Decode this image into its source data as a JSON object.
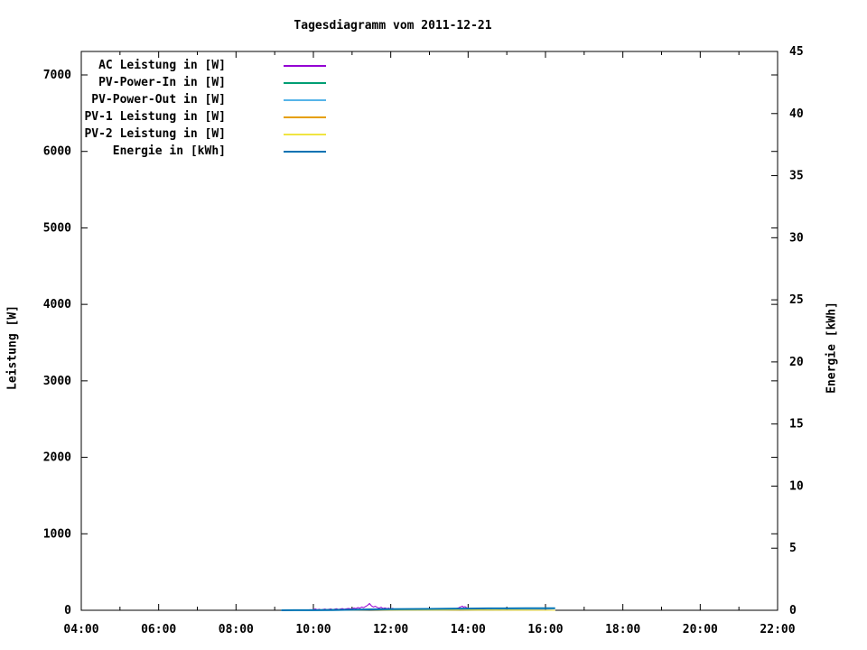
{
  "title": "Tagesdiagramm vom 2011-12-21",
  "chart_data": {
    "type": "line",
    "title": "Tagesdiagramm vom 2011-12-21",
    "background": "#ffffff",
    "grid": false,
    "legend_position": "top-left-inside",
    "x_axis": {
      "range_hours": [
        4,
        22
      ],
      "major_tick_hours": [
        4,
        6,
        8,
        10,
        12,
        14,
        16,
        18,
        20,
        22
      ],
      "minor_tick_hours": [
        5,
        7,
        9,
        11,
        13,
        15,
        17,
        19,
        21
      ],
      "tick_labels": [
        "04:00",
        "06:00",
        "08:00",
        "10:00",
        "12:00",
        "14:00",
        "16:00",
        "18:00",
        "20:00",
        "22:00"
      ]
    },
    "y_left": {
      "label": "Leistung [W]",
      "ticks": [
        0,
        1000,
        2000,
        3000,
        4000,
        5000,
        6000,
        7000
      ],
      "tick_labels": [
        "0",
        "1000",
        "2000",
        "3000",
        "4000",
        "5000",
        "6000",
        "7000"
      ],
      "range": [
        0,
        7310
      ]
    },
    "y_right": {
      "label": "Energie [kWh]",
      "ticks": [
        0,
        5,
        10,
        15,
        20,
        25,
        30,
        35,
        40,
        45
      ],
      "tick_labels": [
        "0",
        "5",
        "10",
        "15",
        "20",
        "25",
        "30",
        "35",
        "40",
        "45"
      ],
      "range": [
        0,
        45
      ]
    },
    "series": [
      {
        "name": "AC Leistung in [W]",
        "color": "#9400d3",
        "yaxis": "left",
        "width": 1,
        "points": [
          [
            9.17,
            1
          ],
          [
            9.3,
            4
          ],
          [
            9.5,
            5
          ],
          [
            9.7,
            6
          ],
          [
            9.9,
            7
          ],
          [
            10.0,
            10
          ],
          [
            10.05,
            18
          ],
          [
            10.1,
            8
          ],
          [
            10.15,
            14
          ],
          [
            10.2,
            6
          ],
          [
            10.3,
            16
          ],
          [
            10.35,
            8
          ],
          [
            10.45,
            18
          ],
          [
            10.5,
            10
          ],
          [
            10.6,
            20
          ],
          [
            10.65,
            12
          ],
          [
            10.75,
            22
          ],
          [
            10.8,
            14
          ],
          [
            10.9,
            24
          ],
          [
            11.0,
            18
          ],
          [
            11.05,
            30
          ],
          [
            11.1,
            22
          ],
          [
            11.15,
            36
          ],
          [
            11.2,
            28
          ],
          [
            11.25,
            42
          ],
          [
            11.3,
            34
          ],
          [
            11.35,
            50
          ],
          [
            11.4,
            65
          ],
          [
            11.45,
            88
          ],
          [
            11.5,
            58
          ],
          [
            11.55,
            42
          ],
          [
            11.6,
            52
          ],
          [
            11.65,
            38
          ],
          [
            11.7,
            28
          ],
          [
            11.75,
            40
          ],
          [
            11.8,
            24
          ],
          [
            11.85,
            32
          ],
          [
            11.9,
            22
          ],
          [
            11.95,
            28
          ],
          [
            12.0,
            16
          ],
          [
            12.05,
            26
          ],
          [
            12.1,
            10
          ],
          [
            12.15,
            18
          ],
          [
            12.2,
            6
          ],
          [
            12.3,
            14
          ],
          [
            12.35,
            4
          ],
          [
            12.45,
            12
          ],
          [
            12.5,
            3
          ],
          [
            12.6,
            10
          ],
          [
            12.7,
            2
          ],
          [
            12.8,
            10
          ],
          [
            12.9,
            3
          ],
          [
            13.0,
            12
          ],
          [
            13.05,
            4
          ],
          [
            13.15,
            14
          ],
          [
            13.25,
            6
          ],
          [
            13.35,
            16
          ],
          [
            13.45,
            8
          ],
          [
            13.55,
            14
          ],
          [
            13.65,
            18
          ],
          [
            13.7,
            24
          ],
          [
            13.75,
            32
          ],
          [
            13.8,
            44
          ],
          [
            13.85,
            54
          ],
          [
            13.88,
            40
          ],
          [
            13.92,
            48
          ],
          [
            13.96,
            34
          ],
          [
            14.0,
            24
          ],
          [
            14.05,
            14
          ],
          [
            14.1,
            8
          ],
          [
            14.2,
            12
          ],
          [
            14.3,
            6
          ],
          [
            14.4,
            9
          ],
          [
            14.5,
            5
          ],
          [
            14.6,
            7
          ],
          [
            14.7,
            4
          ],
          [
            14.8,
            6
          ],
          [
            14.9,
            3
          ],
          [
            15.0,
            5
          ],
          [
            15.1,
            3
          ],
          [
            15.3,
            4
          ],
          [
            15.5,
            2
          ],
          [
            15.7,
            3
          ],
          [
            15.9,
            2
          ],
          [
            16.1,
            1
          ],
          [
            16.25,
            0
          ]
        ]
      },
      {
        "name": "PV-Power-In in [W]",
        "color": "#009e73",
        "yaxis": "left",
        "width": 1,
        "points": [
          [
            9.17,
            0
          ],
          [
            9.5,
            2
          ],
          [
            9.8,
            3
          ],
          [
            10.0,
            4
          ],
          [
            10.2,
            7
          ],
          [
            10.4,
            9
          ],
          [
            10.6,
            11
          ],
          [
            10.8,
            9
          ],
          [
            11.0,
            8
          ],
          [
            11.2,
            9
          ],
          [
            11.45,
            13
          ],
          [
            11.6,
            9
          ],
          [
            11.8,
            7
          ],
          [
            12.0,
            6
          ],
          [
            12.3,
            4
          ],
          [
            12.6,
            3
          ],
          [
            13.0,
            4
          ],
          [
            13.4,
            5
          ],
          [
            13.8,
            9
          ],
          [
            14.0,
            6
          ],
          [
            14.3,
            4
          ],
          [
            14.6,
            3
          ],
          [
            15.0,
            2
          ],
          [
            15.5,
            2
          ],
          [
            16.0,
            1
          ],
          [
            16.25,
            0
          ]
        ]
      },
      {
        "name": "PV-Power-Out in [W]",
        "color": "#56b4e9",
        "yaxis": "left",
        "width": 1,
        "points": [
          [
            9.17,
            0
          ],
          [
            9.6,
            1
          ],
          [
            10.0,
            3
          ],
          [
            10.4,
            6
          ],
          [
            10.8,
            7
          ],
          [
            11.2,
            6
          ],
          [
            11.45,
            9
          ],
          [
            11.8,
            5
          ],
          [
            12.2,
            3
          ],
          [
            12.8,
            2
          ],
          [
            13.4,
            3
          ],
          [
            13.8,
            6
          ],
          [
            14.2,
            3
          ],
          [
            14.8,
            2
          ],
          [
            15.4,
            1
          ],
          [
            16.25,
            0
          ]
        ]
      },
      {
        "name": "PV-1 Leistung in [W]",
        "color": "#e69f00",
        "yaxis": "left",
        "width": 1,
        "points": [
          [
            9.17,
            0
          ],
          [
            10.0,
            2
          ],
          [
            10.5,
            4
          ],
          [
            11.0,
            4
          ],
          [
            11.45,
            6
          ],
          [
            12.0,
            3
          ],
          [
            13.0,
            2
          ],
          [
            13.8,
            4
          ],
          [
            14.5,
            2
          ],
          [
            15.5,
            1
          ],
          [
            16.25,
            0
          ]
        ]
      },
      {
        "name": "PV-2 Leistung in [W]",
        "color": "#f0e442",
        "yaxis": "left",
        "width": 1,
        "points": [
          [
            9.17,
            0
          ],
          [
            10.0,
            2
          ],
          [
            10.5,
            3
          ],
          [
            11.0,
            4
          ],
          [
            11.45,
            5
          ],
          [
            12.0,
            3
          ],
          [
            13.0,
            2
          ],
          [
            13.8,
            4
          ],
          [
            14.5,
            2
          ],
          [
            15.5,
            1
          ],
          [
            16.25,
            0
          ]
        ]
      },
      {
        "name": "Energie in [kWh]",
        "color": "#0072b2",
        "yaxis": "right",
        "width": 2,
        "points": [
          [
            9.17,
            0
          ],
          [
            9.5,
            0.005
          ],
          [
            10.0,
            0.01
          ],
          [
            10.5,
            0.02
          ],
          [
            11.0,
            0.04
          ],
          [
            11.5,
            0.07
          ],
          [
            12.0,
            0.09
          ],
          [
            12.5,
            0.1
          ],
          [
            13.0,
            0.11
          ],
          [
            13.5,
            0.12
          ],
          [
            14.0,
            0.14
          ],
          [
            14.5,
            0.15
          ],
          [
            15.0,
            0.15
          ],
          [
            15.5,
            0.16
          ],
          [
            16.0,
            0.16
          ],
          [
            16.25,
            0.16
          ]
        ]
      }
    ]
  }
}
